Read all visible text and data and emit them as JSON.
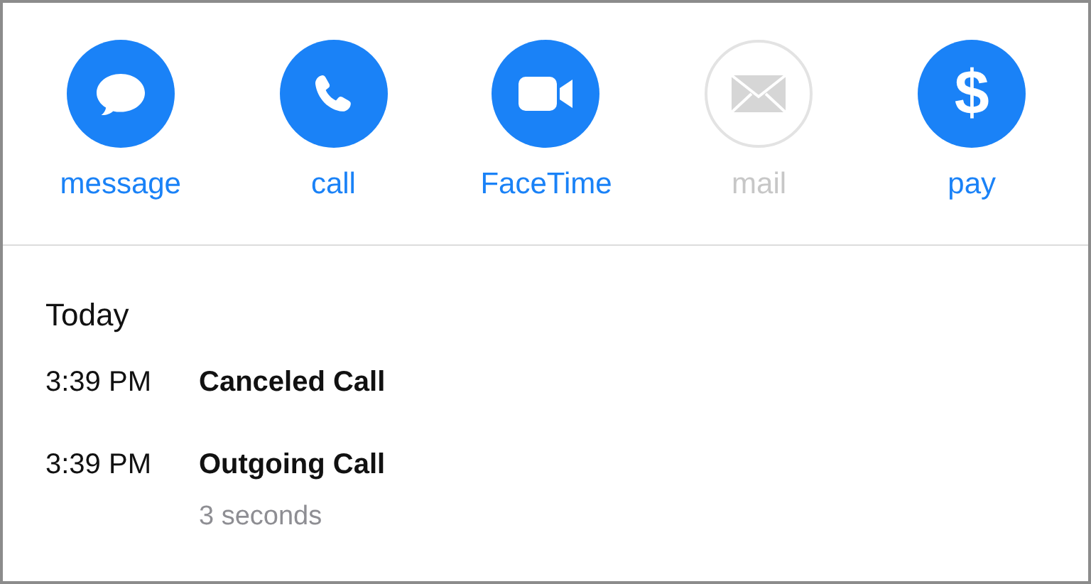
{
  "actions": [
    {
      "kind": "message",
      "label": "message",
      "disabled": false
    },
    {
      "kind": "call",
      "label": "call",
      "disabled": false
    },
    {
      "kind": "video",
      "label": "FaceTime",
      "disabled": false
    },
    {
      "kind": "mail",
      "label": "mail",
      "disabled": true
    },
    {
      "kind": "pay",
      "label": "pay",
      "disabled": false,
      "glyph": "$"
    }
  ],
  "history": {
    "heading": "Today",
    "entries": [
      {
        "time": "3:39 PM",
        "title": "Canceled Call"
      },
      {
        "time": "3:39 PM",
        "title": "Outgoing Call",
        "detail": "3 seconds"
      }
    ]
  }
}
